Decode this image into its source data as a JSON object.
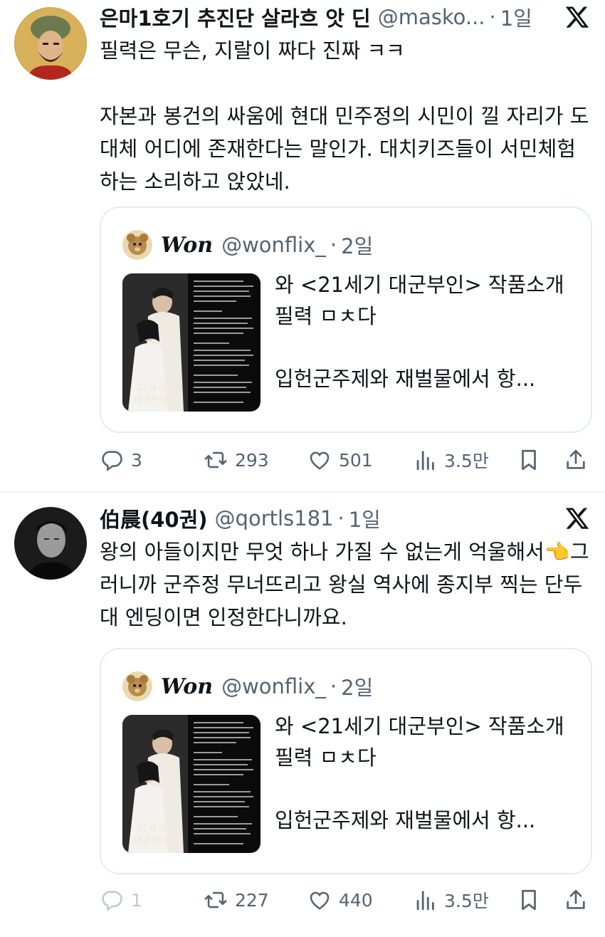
{
  "tweets": [
    {
      "author": {
        "name": "은마1호기 추진단 살라흐 앗 딘",
        "handle": "@masko...",
        "time": "1일"
      },
      "text": "필력은 무슨, 지랄이 짜다 진짜 ㅋㅋ\n\n자본과 봉건의 싸움에 현대 민주정의 시민이 낄 자리가 도대체 어디에 존재한다는 말인가. 대치키즈들이 서민체험하는 소리하고 앉았네.",
      "quote": {
        "name": "Won",
        "handle": "@wonflix_",
        "time": "2일",
        "text": "와 <21세기 대군부인> 작품소개 필력 ㅁㅊ다\n\n입헌군주제와 재벌물에서 항...",
        "poster_title": "21세기\n대군부인"
      },
      "stats": {
        "replies": "3",
        "retweets": "293",
        "likes": "501",
        "views": "3.5만"
      }
    },
    {
      "author": {
        "name": "伯晨(40권)",
        "handle": "@qortls181",
        "time": "1일"
      },
      "text": "왕의 아들이지만 무엇 하나 가질 수 없는게 억울해서👈그러니까 군주정 무너뜨리고 왕실 역사에 종지부 찍는 단두대 엔딩이면 인정한다니까요.",
      "quote": {
        "name": "Won",
        "handle": "@wonflix_",
        "time": "2일",
        "text": "와 <21세기 대군부인> 작품소개 필력 ㅁㅊ다\n\n입헌군주제와 재벌물에서 항...",
        "poster_title": "21세기\n대군부인"
      },
      "stats": {
        "replies": "1",
        "retweets": "227",
        "likes": "440",
        "views": "3.5만"
      }
    }
  ],
  "icons": {
    "logo": "x-logo-icon",
    "reply": "reply-icon",
    "retweet": "retweet-icon",
    "like": "heart-icon",
    "views": "views-icon",
    "bookmark": "bookmark-icon",
    "share": "share-icon"
  },
  "colors": {
    "text": "#0f1419",
    "secondary": "#536471",
    "border": "#e6ecf0",
    "background": "#ffffff"
  }
}
